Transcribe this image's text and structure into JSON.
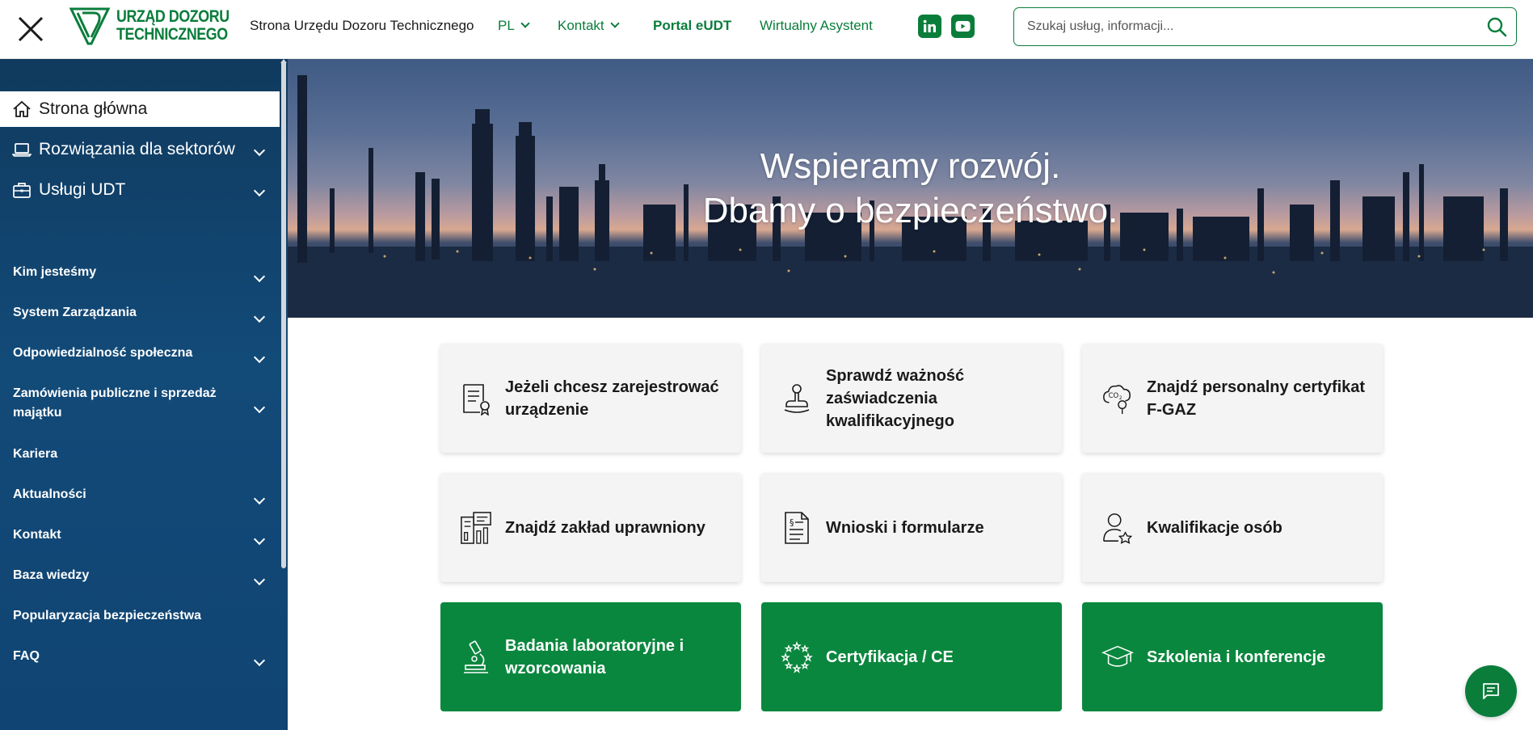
{
  "colors": {
    "brand_green": "#0a7d3b",
    "tile_green": "#0a873e",
    "sidebar_blue": "#124a78"
  },
  "header": {
    "logo": {
      "line1": "URZĄD DOZORU",
      "line2": "TECHNICZNEGO"
    },
    "nav": {
      "home": "Strona Urzędu Dozoru Technicznego",
      "lang": "PL",
      "contact": "Kontakt",
      "portal": "Portal eUDT",
      "assistant": "Wirtualny Asystent"
    },
    "social": [
      "linkedin-icon",
      "youtube-icon"
    ],
    "search": {
      "placeholder": "Szukaj usług, informacji..."
    }
  },
  "sidebar": {
    "main": [
      {
        "label": "Strona główna",
        "icon": "home-icon",
        "active": true
      },
      {
        "label": "Rozwiązania dla sektorów",
        "icon": "laptop-icon"
      },
      {
        "label": "Usługi UDT",
        "icon": "briefcase-icon"
      }
    ],
    "items": [
      {
        "label": "Kim jesteśmy",
        "expandable": true
      },
      {
        "label": "System Zarządzania",
        "expandable": true
      },
      {
        "label": "Odpowiedzialność społeczna",
        "expandable": true
      },
      {
        "label": "Zamówienia publiczne i sprzedaż majątku",
        "expandable": true
      },
      {
        "label": "Kariera",
        "expandable": false
      },
      {
        "label": "Aktualności",
        "expandable": true
      },
      {
        "label": "Kontakt",
        "expandable": true
      },
      {
        "label": "Baza wiedzy",
        "expandable": true
      },
      {
        "label": "Popularyzacja bezpieczeństwa",
        "expandable": false
      },
      {
        "label": "FAQ",
        "expandable": true
      }
    ]
  },
  "hero": {
    "line1": "Wspieramy rozwój.",
    "line2": "Dbamy o bezpieczeństwo."
  },
  "tiles": [
    {
      "label": "Jeżeli chcesz zarejestrować urządzenie",
      "icon": "certificate-document-icon",
      "style": "light"
    },
    {
      "label": "Sprawdź ważność zaświadczenia kwalifikacyjnego",
      "icon": "stamp-icon",
      "style": "light"
    },
    {
      "label": "Znajdź personalny certyfikat F-GAZ",
      "icon": "co2-cloud-icon",
      "style": "light"
    },
    {
      "label": "Znajdź zakład uprawniony",
      "icon": "building-chart-icon",
      "style": "light"
    },
    {
      "label": "Wnioski i formularze",
      "icon": "legal-document-icon",
      "style": "light"
    },
    {
      "label": "Kwalifikacje osób",
      "icon": "person-badge-icon",
      "style": "light"
    },
    {
      "label": "Badania laboratoryjne i wzorcowania",
      "icon": "microscope-icon",
      "style": "green"
    },
    {
      "label": "Certyfikacja / CE",
      "icon": "eu-stars-icon",
      "style": "green"
    },
    {
      "label": "Szkolenia i konferencje",
      "icon": "graduation-cap-icon",
      "style": "green"
    }
  ],
  "chat": {
    "icon": "chat-icon"
  }
}
